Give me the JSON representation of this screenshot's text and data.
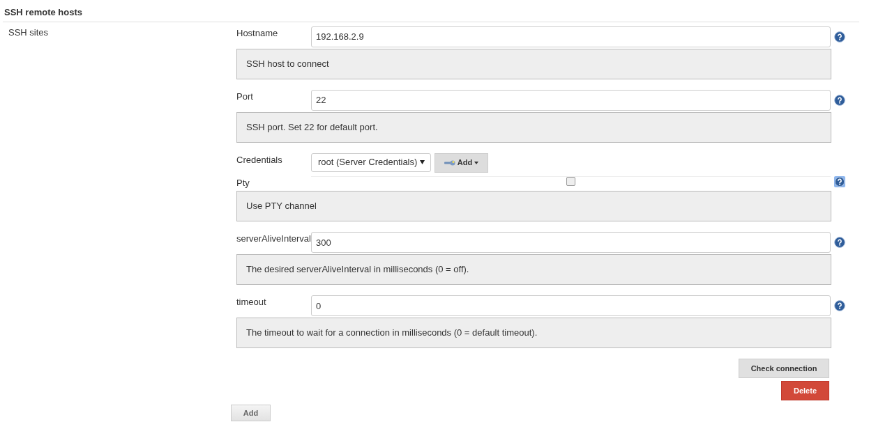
{
  "section": {
    "title": "SSH remote hosts"
  },
  "property": {
    "label": "SSH sites"
  },
  "fields": [
    {
      "kind": "text",
      "label": "Hostname",
      "value": "192.168.2.9",
      "help": "SSH host to connect",
      "help_highlighted": false
    },
    {
      "kind": "text",
      "label": "Port",
      "value": "22",
      "help": "SSH port. Set 22 for default port.",
      "help_highlighted": false
    },
    {
      "kind": "select",
      "label": "Credentials",
      "value": "root (Server Credentials)",
      "add_button": "Add"
    },
    {
      "kind": "checkbox",
      "label": "Pty",
      "checked": false,
      "help": "Use PTY channel",
      "help_highlighted": true
    },
    {
      "kind": "text",
      "label": "serverAliveInterval",
      "value": "300",
      "help": "The desired serverAliveInterval in milliseconds (0 = off).",
      "help_highlighted": false
    },
    {
      "kind": "text",
      "label": "timeout",
      "value": "0",
      "help": "The timeout to wait for a connection in milliseconds (0 = default timeout).",
      "help_highlighted": false
    }
  ],
  "actions": [
    {
      "kind": "secondary",
      "label": "Check connection"
    },
    {
      "kind": "danger",
      "label": "Delete"
    }
  ],
  "add_button": {
    "label": "Add"
  }
}
